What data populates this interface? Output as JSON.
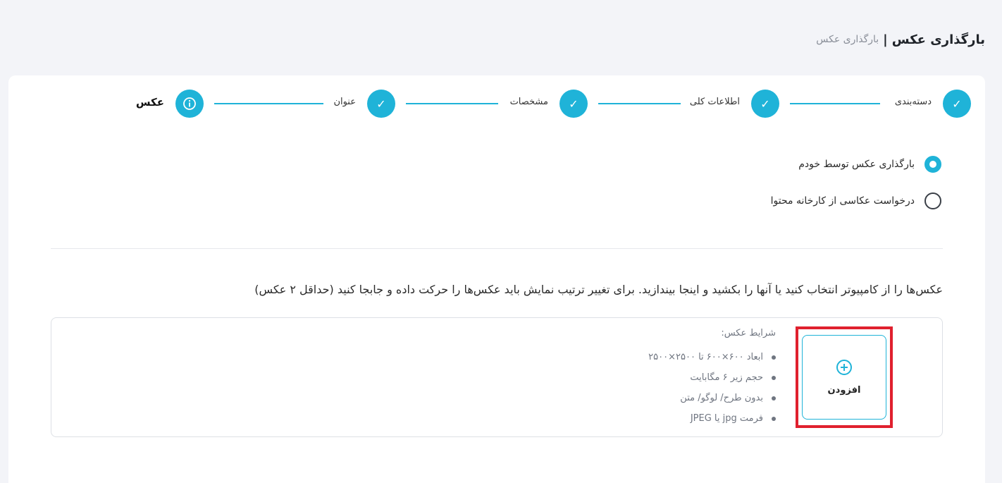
{
  "header": {
    "title": "بارگذاری عکس",
    "separator": "|",
    "breadcrumb": "بارگذاری عکس"
  },
  "stepper": {
    "steps": [
      {
        "label": "دسته‌بندی",
        "status": "done",
        "icon": "check-icon"
      },
      {
        "label": "اطلاعات کلی",
        "status": "done",
        "icon": "check-icon"
      },
      {
        "label": "مشخصات",
        "status": "done",
        "icon": "check-icon"
      },
      {
        "label": "عنوان",
        "status": "done",
        "icon": "check-icon"
      },
      {
        "label": "عکس",
        "status": "active",
        "icon": "info-icon"
      }
    ]
  },
  "options": {
    "self_upload": "بارگذاری عکس توسط خودم",
    "studio_request": "درخواست عکاسی از کارخانه محتوا",
    "selected": "self_upload"
  },
  "instruction": "عکس‌ها را از کامپیوتر انتخاب کنید یا آنها را بکشید و اینجا بیندازید. برای تغییر ترتیب نمایش باید عکس‌ها را حرکت داده و جابجا کنید (حداقل ۲ عکس)",
  "upload": {
    "add_label": "افزودن",
    "conditions_title": "شرایط عکس:",
    "conditions": [
      "ابعاد ۶۰۰×۶۰۰ تا ۲۵۰۰×۲۵۰۰",
      "حجم زیر ۶ مگابایت",
      "بدون  طرح/ لوگو/ متن",
      "فرمت jpg یا JPEG"
    ]
  },
  "colors": {
    "accent": "#1fb3d8",
    "highlight": "#e0202e",
    "background": "#f3f4f8"
  }
}
